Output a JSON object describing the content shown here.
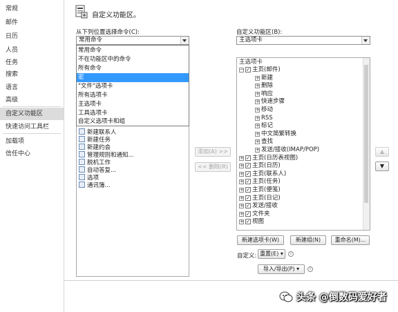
{
  "sidebar": {
    "items": [
      "常规",
      "邮件",
      "日历",
      "人员",
      "任务",
      "搜索",
      "语言",
      "高级",
      "自定义功能区",
      "快速访问工具栏",
      "加载项",
      "信任中心"
    ],
    "active_index": 8
  },
  "header": {
    "title": "自定义功能区。",
    "icon": "customize-ribbon-icon"
  },
  "left_panel": {
    "label": "从下列位置选择命令(C):",
    "combo_value": "常用命令",
    "dropdown_options": [
      "常用命令",
      "不在功能区中的命令",
      "所有命令",
      "宏",
      "\"文件\"选项卡",
      "所有选项卡",
      "主选项卡",
      "工具选项卡",
      "自定义选项卡和组"
    ],
    "selected_option": "宏",
    "commands": [
      "新建联系人",
      "新建任务",
      "新建约会",
      "管理规则和通知...",
      "脱机工作",
      "自动答复...",
      "选项",
      "通讯簿..."
    ]
  },
  "middle": {
    "add_label": "添加(A) >>",
    "remove_label": "<< 删除(R)"
  },
  "right_panel": {
    "label": "自定义功能区(B):",
    "combo_value": "主选项卡",
    "tree_header": "主选项卡",
    "tree": [
      {
        "text": "主页(邮件)",
        "level": 0,
        "pm": "−",
        "check": true
      },
      {
        "text": "新建",
        "level": 1,
        "pm": "+"
      },
      {
        "text": "删除",
        "level": 1,
        "pm": "+"
      },
      {
        "text": "响应",
        "level": 1,
        "pm": "+"
      },
      {
        "text": "快速步骤",
        "level": 1,
        "pm": "+"
      },
      {
        "text": "移动",
        "level": 1,
        "pm": "+"
      },
      {
        "text": "RSS",
        "level": 1,
        "pm": "+"
      },
      {
        "text": "标记",
        "level": 1,
        "pm": "+"
      },
      {
        "text": "中文简繁转换",
        "level": 1,
        "pm": "+"
      },
      {
        "text": "查找",
        "level": 1,
        "pm": "+"
      },
      {
        "text": "发送/接收(IMAP/POP)",
        "level": 1,
        "pm": "+"
      },
      {
        "text": "主页(日历表视图)",
        "level": 0,
        "pm": "+",
        "check": true
      },
      {
        "text": "主页(日历)",
        "level": 0,
        "pm": "+",
        "check": true
      },
      {
        "text": "主页(联系人)",
        "level": 0,
        "pm": "+",
        "check": true
      },
      {
        "text": "主页(任务)",
        "level": 0,
        "pm": "+",
        "check": true
      },
      {
        "text": "主页(便笺)",
        "level": 0,
        "pm": "+",
        "check": true
      },
      {
        "text": "主页(日记)",
        "level": 0,
        "pm": "+",
        "check": true
      },
      {
        "text": "发送/接收",
        "level": 0,
        "pm": "+",
        "check": true
      },
      {
        "text": "文件夹",
        "level": 0,
        "pm": "+",
        "check": true
      },
      {
        "text": "视图",
        "level": 0,
        "pm": "+",
        "check": true
      }
    ],
    "new_tab_label": "新建选项卡(W)",
    "new_group_label": "新建组(N)",
    "rename_label": "重命名(M)...",
    "custom_label": "自定义:",
    "reset_label": "重置(E) ▾",
    "import_export_label": "导入/导出(P) ▾",
    "move_up": "▲",
    "move_down": "▼"
  },
  "watermark": {
    "text": "头条 @倒数码爱好者",
    "icon": "wechat-icon"
  }
}
